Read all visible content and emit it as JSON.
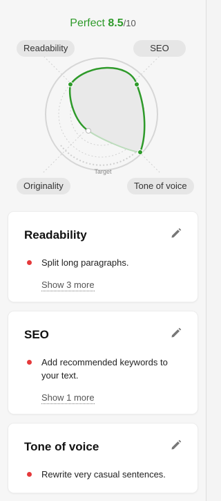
{
  "score": {
    "label": "Perfect",
    "value": "8.5",
    "max": "/10"
  },
  "radar": {
    "axes": [
      "Readability",
      "SEO",
      "Originality",
      "Tone of voice"
    ],
    "target_label": "Target",
    "colors": {
      "accent": "#2e9a2a",
      "chip_bg": "#e6e6e6"
    }
  },
  "cards": [
    {
      "title": "Readability",
      "items": [
        "Split long paragraphs."
      ],
      "show_more": "Show 3 more"
    },
    {
      "title": "SEO",
      "items": [
        "Add recommended keywords to your text."
      ],
      "show_more": "Show 1 more"
    },
    {
      "title": "Tone of voice",
      "items": [
        "Rewrite very casual sentences."
      ]
    }
  ],
  "icons": {
    "edit": "pencil-icon",
    "bullet": "red-dot-icon"
  }
}
